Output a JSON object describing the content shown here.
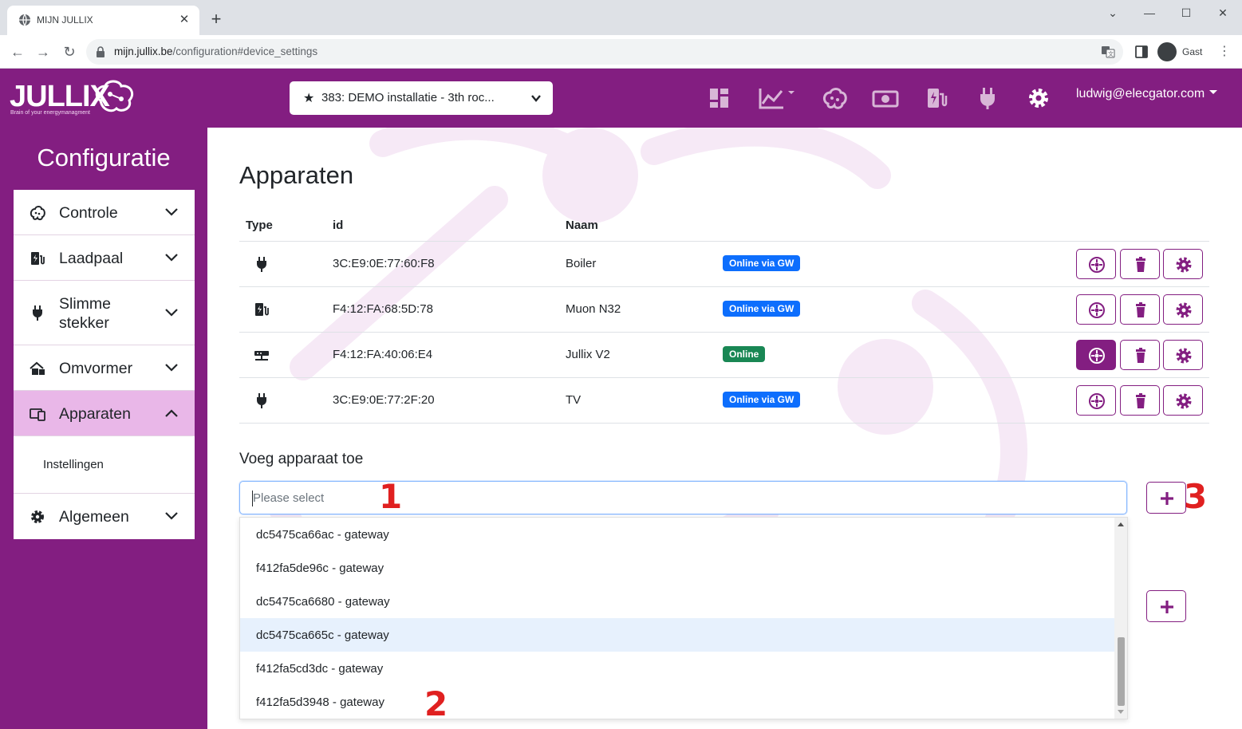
{
  "browser": {
    "tab_title": "MIJN JULLIX",
    "url_host": "mijn.jullix.be",
    "url_path": "/configuration#device_settings",
    "profile_name": "Gast"
  },
  "navbar": {
    "logo_text": "JULLIX",
    "logo_tagline": "Brain of your energymanagment",
    "installation": "383: DEMO installatie - 3th roc...",
    "user_email": "ludwig@elecgator.com",
    "icons": [
      "dashboard-icon",
      "chart-icon",
      "brain-icon",
      "money-icon",
      "charger-icon",
      "plug-icon",
      "gear-icon"
    ]
  },
  "sidebar": {
    "heading": "Configuratie",
    "items": [
      {
        "label": "Controle",
        "icon": "brain-icon"
      },
      {
        "label": "Laadpaal",
        "icon": "charger-icon"
      },
      {
        "label": "Slimme stekker",
        "icon": "plug-icon"
      },
      {
        "label": "Omvormer",
        "icon": "house-solar-icon"
      },
      {
        "label": "Apparaten",
        "icon": "devices-icon",
        "active": true,
        "sub": [
          "Instellingen"
        ]
      },
      {
        "label": "Algemeen",
        "icon": "gear-icon"
      }
    ]
  },
  "main": {
    "title": "Apparaten",
    "columns": [
      "Type",
      "id",
      "Naam"
    ],
    "devices": [
      {
        "type": "plug",
        "id": "3C:E9:0E:77:60:F8",
        "name": "Boiler",
        "status": "Online via GW",
        "status_color": "#0d6efd"
      },
      {
        "type": "charger",
        "id": "F4:12:FA:68:5D:78",
        "name": "Muon N32",
        "status": "Online via GW",
        "status_color": "#0d6efd"
      },
      {
        "type": "gateway",
        "id": "F4:12:FA:40:06:E4",
        "name": "Jullix V2",
        "status": "Online",
        "status_color": "#198754"
      },
      {
        "type": "plug",
        "id": "3C:E9:0E:77:2F:20",
        "name": "TV",
        "status": "Online via GW",
        "status_color": "#0d6efd"
      }
    ],
    "add_title": "Voeg apparaat toe",
    "select_placeholder": "Please select",
    "options": [
      "dc5475ca66ac - gateway",
      "f412fa5de96c - gateway",
      "dc5475ca6680 - gateway",
      "dc5475ca665c - gateway",
      "f412fa5cd3dc - gateway",
      "f412fa5d3948 - gateway"
    ],
    "highlighted_option": "dc5475ca665c - gateway",
    "annotations": [
      "1",
      "2",
      "3"
    ]
  },
  "colors": {
    "brand": "#831e81",
    "brand_light": "#e9b7e8",
    "badge_blue": "#0d6efd",
    "badge_green": "#198754"
  }
}
